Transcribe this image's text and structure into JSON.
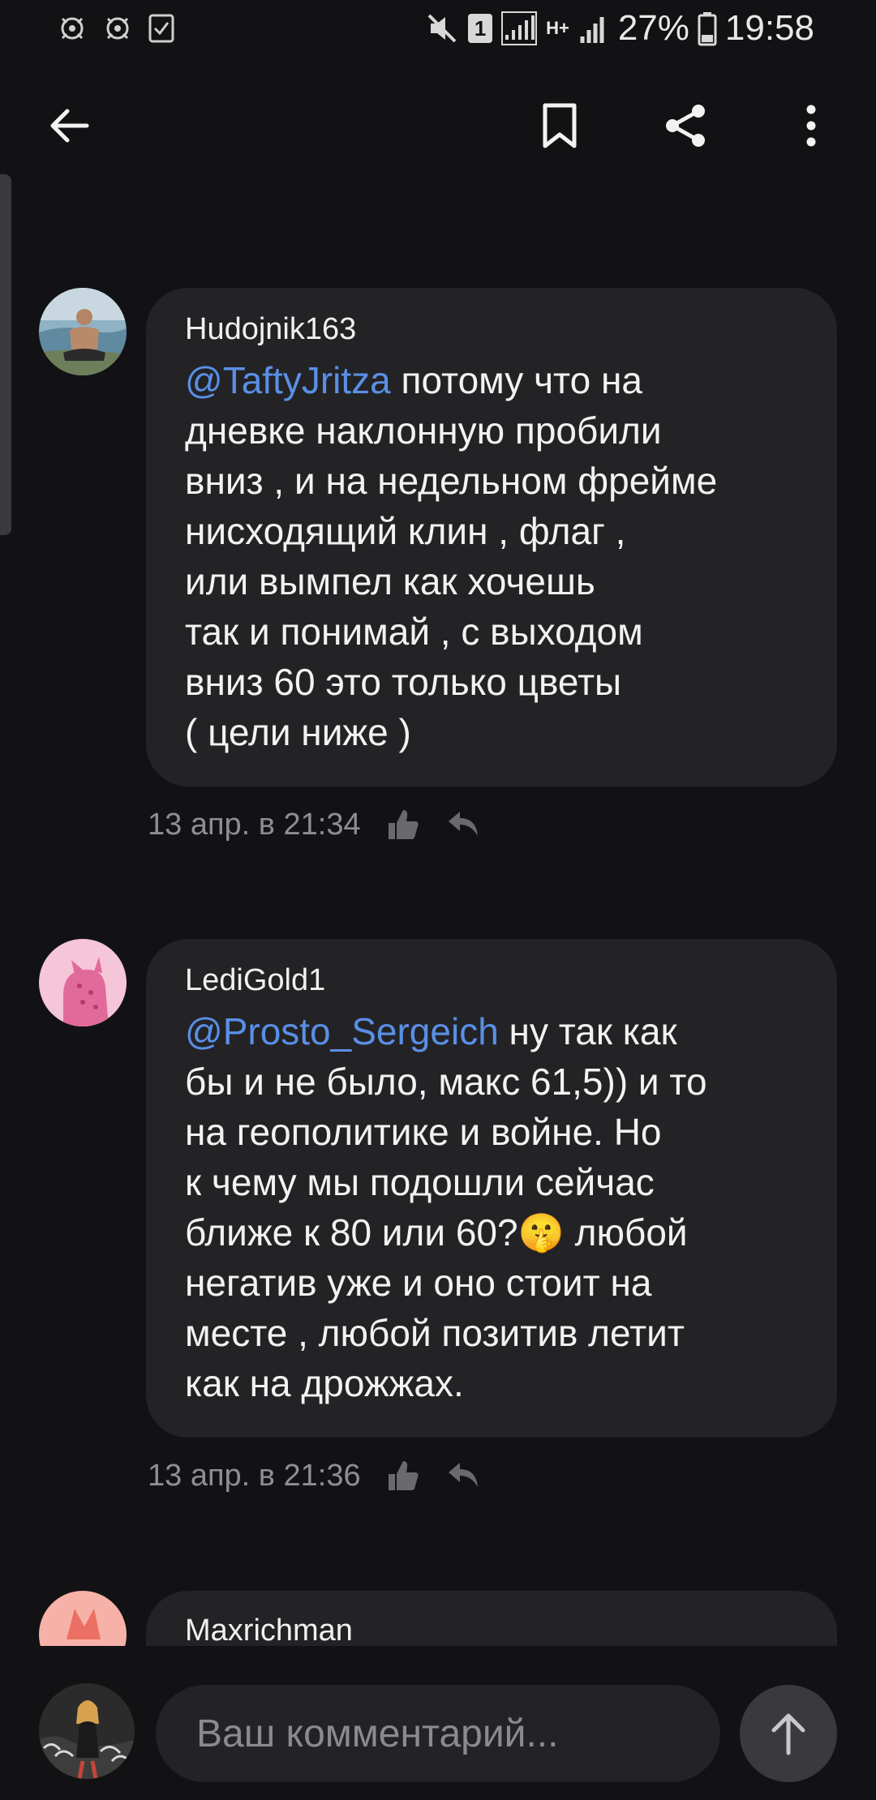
{
  "status_bar": {
    "battery_percent": "27%",
    "time": "19:58",
    "network": "H+",
    "sim_badge": "1"
  },
  "top_bar": {
    "back_icon": "arrow-left-icon",
    "bookmark_icon": "bookmark-icon",
    "share_icon": "share-icon",
    "menu_icon": "more-vertical-icon"
  },
  "comments": [
    {
      "author": "Hudojnik163",
      "mention": "@TaftyJritza",
      "lines": [
        " потому что на",
        "дневке наклонную пробили",
        "вниз , и на недельном фрейме",
        "нисходящий клин , флаг ,",
        "или вымпел как хочешь",
        "так и понимай , с выходом",
        "вниз 60 это только цветы",
        "( цели ниже )"
      ],
      "timestamp": "13 апр. в 21:34"
    },
    {
      "author": "LediGold1",
      "mention": "@Prosto_Sergeich",
      "lines": [
        " ну так как",
        "бы и не было, макс 61,5)) и то",
        "на геополитике и войне. Но",
        "к чему мы подошли сейчас",
        "ближе к 80 или 60?",
        "негатив уже и оно стоит на",
        "месте , любой позитив летит",
        "как на дрожжах."
      ],
      "emoji": "🤫",
      "after_emoji": " любой",
      "timestamp": "13 апр. в 21:36"
    },
    {
      "author": "Maxrichman"
    }
  ],
  "input": {
    "placeholder": "Ваш комментарий..."
  },
  "colors": {
    "background": "#121214",
    "bubble": "#232326",
    "mention": "#5a8fe6",
    "meta": "#8e8e93"
  }
}
